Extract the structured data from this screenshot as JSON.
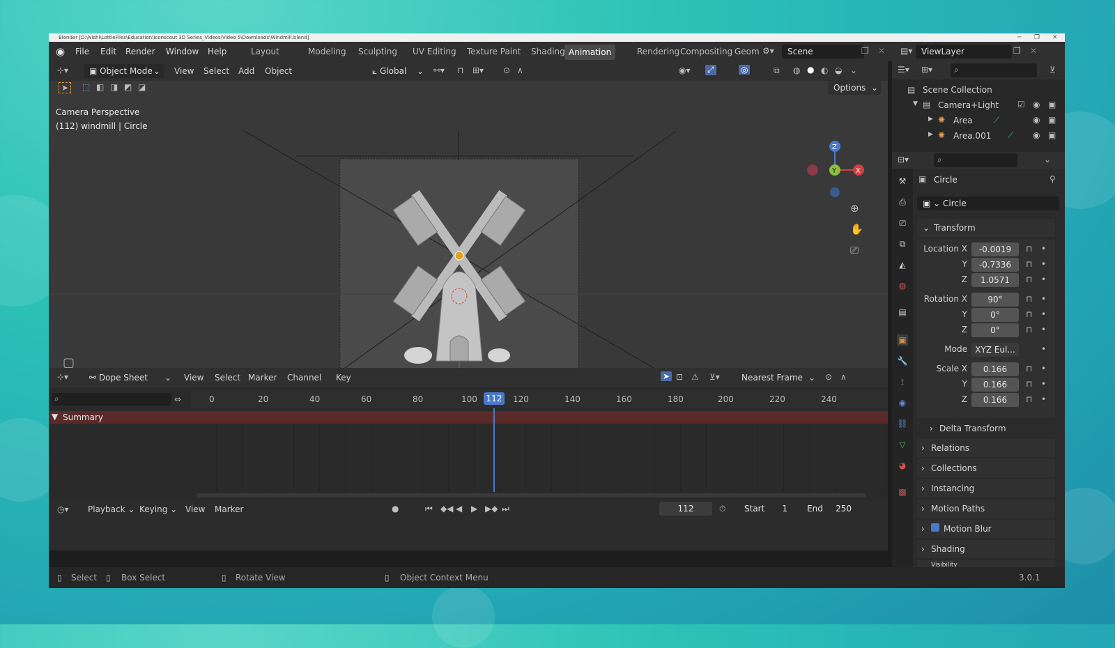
{
  "window": {
    "title": "Blender [D:\\Nishi\\LottieFiles\\Education\\Iconscout 3D Series_Videos\\Video 5\\Downloads\\Windmill.blend]"
  },
  "menu": [
    "File",
    "Edit",
    "Render",
    "Window",
    "Help"
  ],
  "workspaces": [
    {
      "label": "Layout"
    },
    {
      "label": "Modeling"
    },
    {
      "label": "Sculpting"
    },
    {
      "label": "UV Editing"
    },
    {
      "label": "Texture Paint"
    },
    {
      "label": "Shading"
    },
    {
      "label": "Animation",
      "active": true
    },
    {
      "label": "Rendering"
    },
    {
      "label": "Compositing"
    },
    {
      "label": "Geom"
    }
  ],
  "scene": {
    "name": "Scene"
  },
  "view_layer": {
    "name": "ViewLayer"
  },
  "viewport": {
    "mode": "Object Mode",
    "menus": [
      "View",
      "Select",
      "Add",
      "Object"
    ],
    "transform_orientation": "Global",
    "options_label": "Options",
    "camera_label": "Camera Perspective",
    "object_label": "(112) windmill | Circle",
    "gizmo": {
      "x": "X",
      "y": "Y",
      "z": "Z"
    }
  },
  "outliner": {
    "root": "Scene Collection",
    "items": [
      {
        "label": "Camera+Light"
      },
      {
        "label": "Area"
      },
      {
        "label": "Area.001"
      }
    ]
  },
  "properties": {
    "object_name": "Circle",
    "data_name": "Circle",
    "transform_label": "Transform",
    "location": {
      "label": "Location X",
      "x": "-0.0019",
      "y": "-0.7336",
      "z": "1.0571"
    },
    "rotation": {
      "label": "Rotation X",
      "x": "90°",
      "y": "0°",
      "z": "0°"
    },
    "mode": {
      "label": "Mode",
      "value": "XYZ Eul..."
    },
    "scale": {
      "label": "Scale X",
      "x": "0.166",
      "y": "0.166",
      "z": "0.166"
    },
    "axis_y": "Y",
    "axis_z": "Z",
    "delta_transform": "Delta Transform",
    "panels": [
      "Relations",
      "Collections",
      "Instancing",
      "Motion Paths",
      "Motion Blur",
      "Shading",
      "Visibility"
    ]
  },
  "dopesheet": {
    "editor": "Dope Sheet",
    "menus": [
      "View",
      "Select",
      "Marker",
      "Channel",
      "Key"
    ],
    "snap": "Nearest Frame",
    "summary": "Summary",
    "ticks": [
      "0",
      "20",
      "40",
      "60",
      "80",
      "100",
      "120",
      "140",
      "160",
      "180",
      "200",
      "220",
      "240"
    ],
    "current_frame": "112"
  },
  "timeline": {
    "menus": [
      "Playback",
      "Keying",
      "View",
      "Marker"
    ],
    "current_frame": "112",
    "start_label": "Start",
    "start": "1",
    "end_label": "End",
    "end": "250"
  },
  "status": {
    "select": "Select",
    "box_select": "Box Select",
    "rotate_view": "Rotate View",
    "context_menu": "Object Context Menu",
    "version": "3.0.1"
  }
}
